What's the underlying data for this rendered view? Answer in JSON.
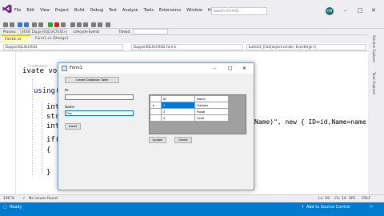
{
  "vs": {
    "menu": [
      "File",
      "Edit",
      "View",
      "Project",
      "Build",
      "Debug",
      "Test",
      "Analyze",
      "Tools",
      "Extensions",
      "Window",
      "Help"
    ],
    "search_placeholder": "Search (Ctrl+Q)",
    "avatar_initials": "OM",
    "preview_label": "PREVIEW",
    "toolbar": {
      "process_label": "Process:",
      "process_value": "[4448] DapperSQLiteCRUD.exe",
      "lifecycle_label": "Lifecycle Events",
      "thread_label": "Thread:"
    },
    "tabs": [
      {
        "label": "Form1.cs",
        "active": true
      },
      {
        "label": "Form1.cs [Design]",
        "active": false
      }
    ],
    "nav": {
      "project": "DapperSQLiteCRUD",
      "class": "DapperSQLiteCRUD.Form1",
      "member": "button2_Click(object sender, EventArgs e)"
    },
    "code": {
      "references_hint": "1 reference",
      "line_private": "ivate void",
      "line_using": "using(IDb",
      "line_int": "int",
      "line_str": "str",
      "line_int2": "int",
      "line_if": "if(ro",
      "brace_open": "{",
      "brace_close": "}",
      "trailing_expression": "Name)\", new { ID=id,Name=name });"
    },
    "side_labels": [
      "Solution Explorer",
      "Team Explorer"
    ],
    "status": {
      "issues": "No issues found",
      "zoom": "100 %",
      "position": "Ln: 59",
      "col": "Ch: 14",
      "spc": "SPC",
      "crlf": "CRLF",
      "ready": "Ready",
      "source_control": "Add to Source Control"
    }
  },
  "form": {
    "title": "Form1",
    "create_button": "Create Database Table",
    "id_label": "ID",
    "id_value": "",
    "name_label": "Name",
    "name_value": "Pos",
    "insert_button": "Insert",
    "update_button": "Update",
    "delete_button": "Delete",
    "grid": {
      "columns": [
        "ID",
        "Name"
      ],
      "rows": [
        {
          "id": "1",
          "name": "Gautam",
          "selected": true
        },
        {
          "id": "2",
          "name": "Rosal",
          "selected": false
        },
        {
          "id": "3",
          "name": "Scott",
          "selected": false
        }
      ]
    }
  },
  "colors": {
    "statusbar": "#007acc",
    "preview": "#d32f2f",
    "selection": "#0078d7",
    "keyword": "#0000ff"
  }
}
